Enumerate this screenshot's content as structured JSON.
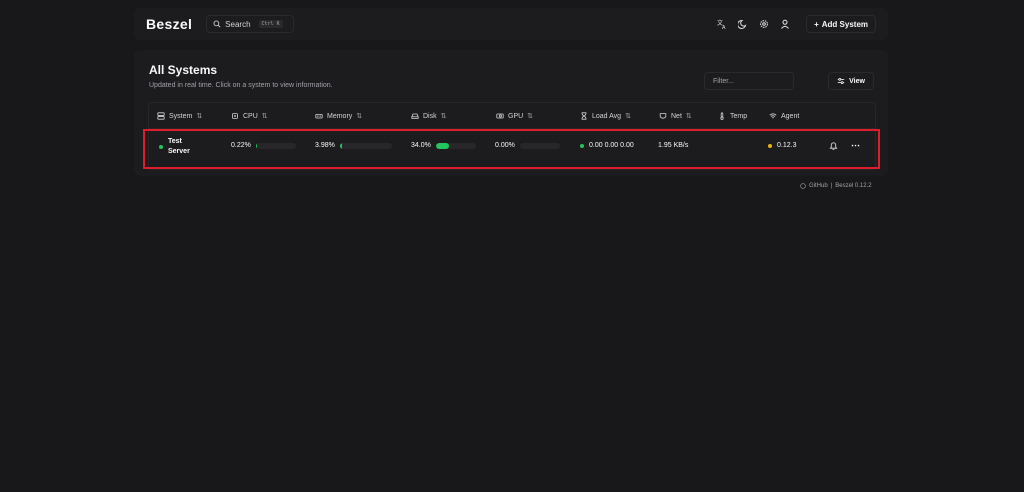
{
  "app": {
    "logo": "Beszel",
    "search": {
      "label": "Search",
      "shortcut": "Ctrl K"
    },
    "add_system": "Add System",
    "icons": [
      "translate-icon",
      "theme-toggle-icon",
      "settings-icon",
      "user-icon"
    ]
  },
  "main": {
    "title": "All Systems",
    "subtitle": "Updated in real time. Click on a system to view information.",
    "filter_placeholder": "Filter...",
    "view_label": "View"
  },
  "table": {
    "columns": [
      "System",
      "CPU",
      "Memory",
      "Disk",
      "GPU",
      "Load Avg",
      "Net",
      "Temp",
      "Agent"
    ],
    "rows": [
      {
        "name_line1": "Test",
        "name_line2": "Server",
        "status": "up",
        "cpu": "0.22%",
        "cpu_pct": 0.22,
        "memory": "3.98%",
        "memory_pct": 3.98,
        "disk": "34.0%",
        "disk_pct": 34.0,
        "gpu": "0.00%",
        "gpu_pct": 0.0,
        "load_avg": "0.00 0.00 0.00",
        "net": "1.95 KB/s",
        "temp": "",
        "agent": "0.12.3"
      }
    ]
  },
  "footer": {
    "github": "GitHub",
    "version": "Beszel 0.12.2"
  },
  "colors": {
    "background": "#18181b",
    "card": "#1c1c1f",
    "accent_green": "#22c55e",
    "agent_dot": "#eab308",
    "highlight": "#e01e2b"
  }
}
